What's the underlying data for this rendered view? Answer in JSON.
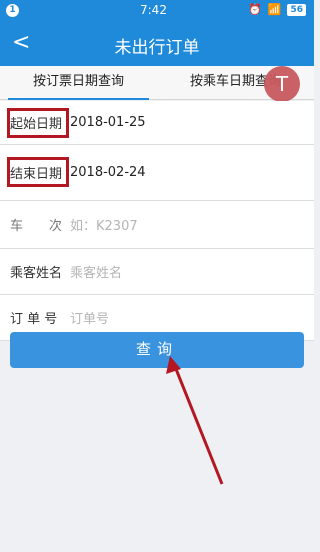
{
  "status": {
    "time": "7:42",
    "notif": "1",
    "battery": "56"
  },
  "nav": {
    "back": "<",
    "title": "未出行订单"
  },
  "tabs": [
    {
      "label": "按订票日期查询"
    },
    {
      "label": "按乘车日期查询"
    }
  ],
  "tool_icon": "T",
  "form": {
    "start_label": "起始日期",
    "start_value": "2018-01-25",
    "end_label": "结束日期",
    "end_value": "2018-02-24",
    "train_label": "车　　次",
    "train_placeholder": "如：K2307",
    "passenger_label": "乘客姓名",
    "passenger_placeholder": "乘客姓名",
    "order_label": "订 单 号",
    "order_placeholder": "订单号"
  },
  "button": {
    "query": "查询"
  },
  "colors": {
    "primary": "#1f8ad9",
    "button": "#3a93df",
    "highlight": "#b31822"
  }
}
